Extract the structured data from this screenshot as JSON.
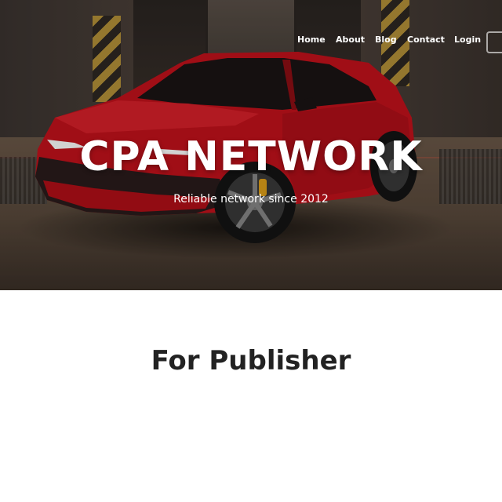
{
  "nav": {
    "items": [
      {
        "label": "Home"
      },
      {
        "label": "About"
      },
      {
        "label": "Blog"
      },
      {
        "label": "Contact"
      },
      {
        "label": "Login"
      }
    ]
  },
  "hero": {
    "title": "CPA NETWORK",
    "subtitle": "Reliable network since 2012",
    "image": "red-suv-in-garage"
  },
  "section": {
    "title": "For Publisher"
  },
  "colors": {
    "car_red": "#c4121c",
    "heading_text": "#222222",
    "hero_text": "#ffffff"
  }
}
